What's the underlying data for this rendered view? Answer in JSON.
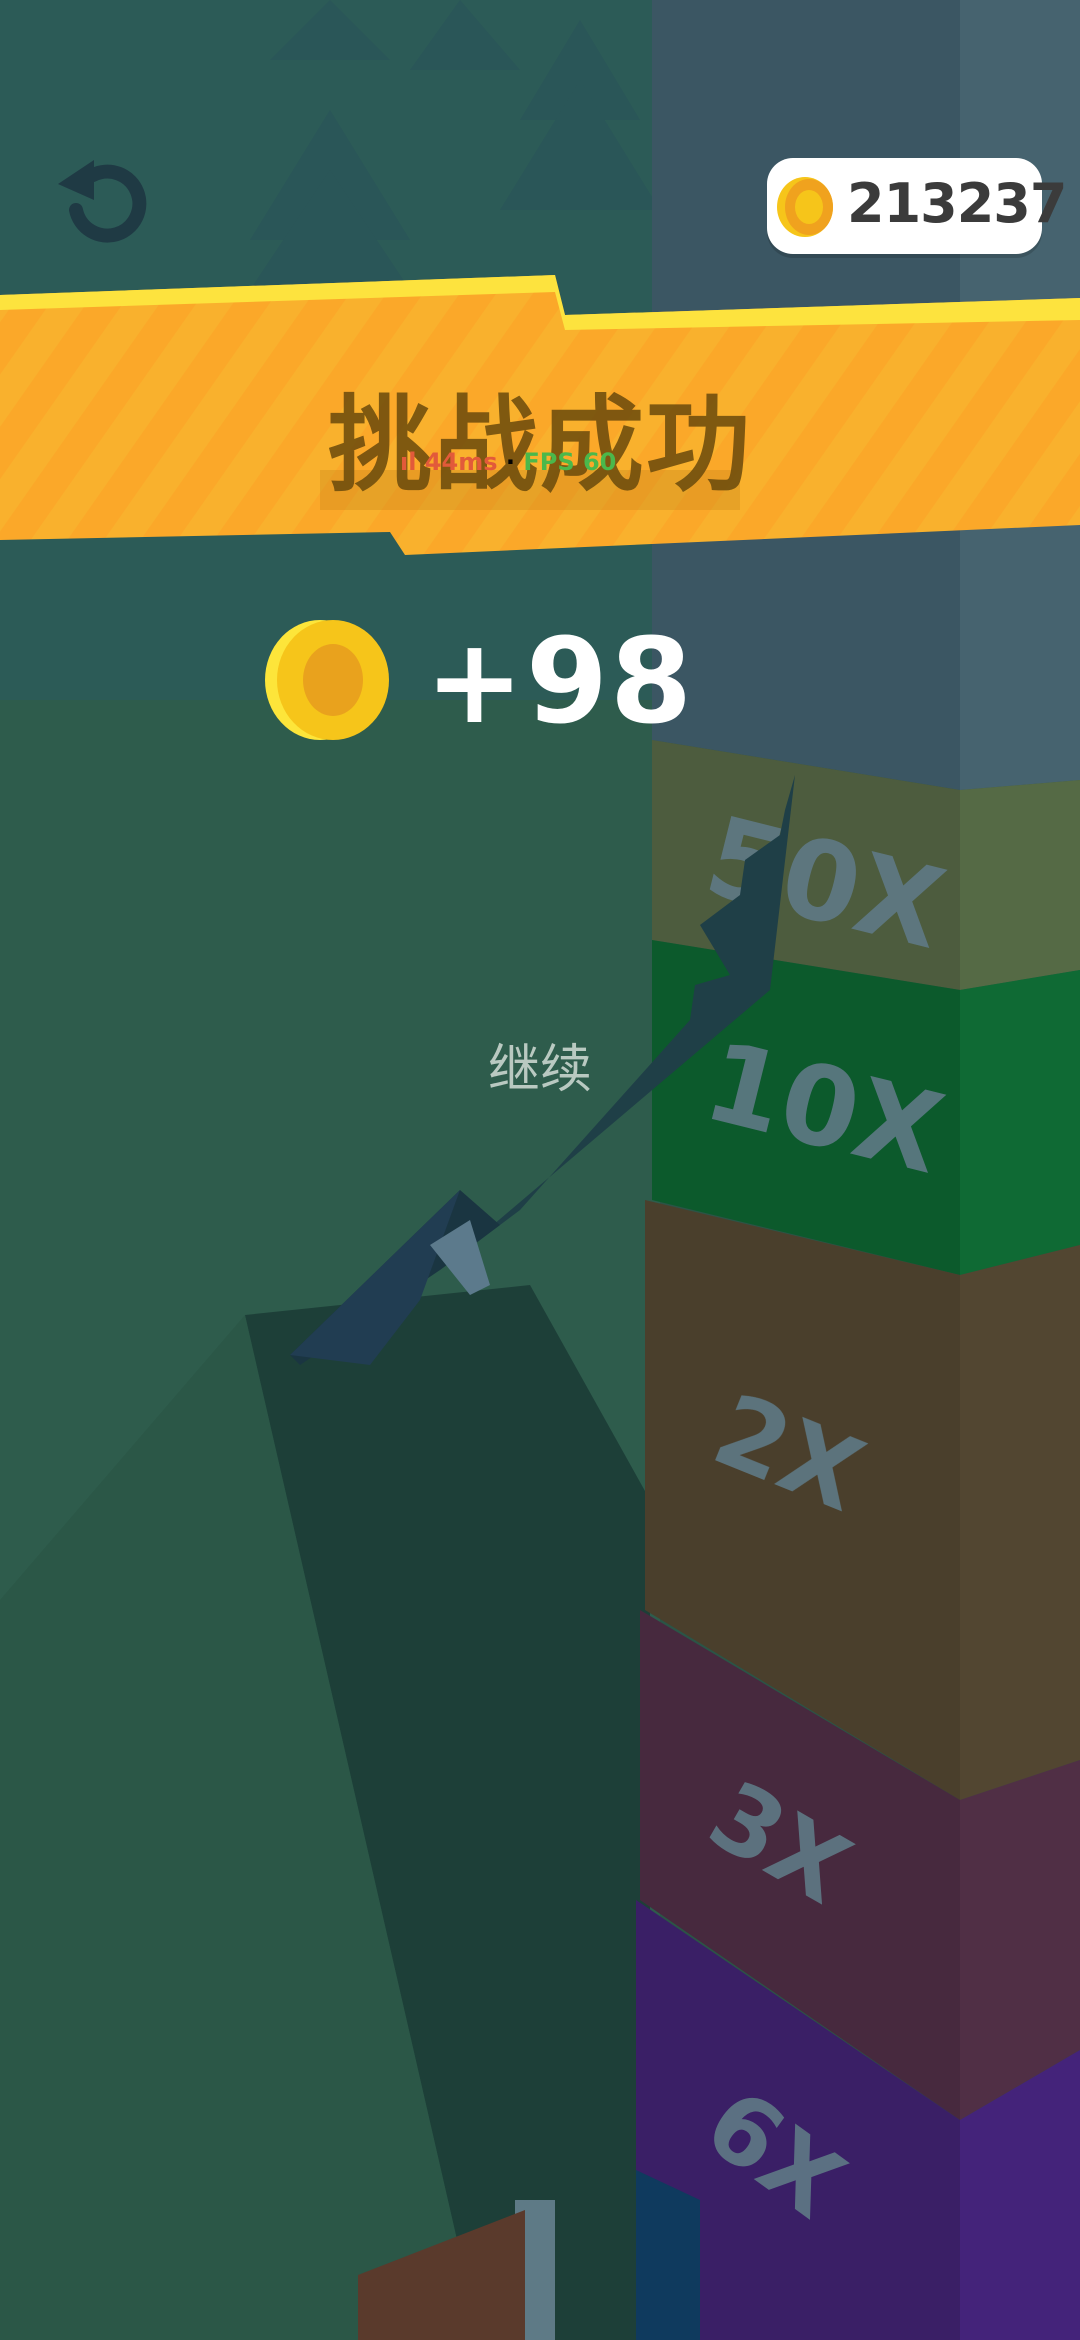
{
  "hud": {
    "coins": "213237",
    "restart_icon": "restart-icon",
    "coin_icon": "coin-icon"
  },
  "result": {
    "title": "挑战成功",
    "reward": "+98",
    "continue_label": "继续"
  },
  "debug": {
    "ping": "ıl 44ms",
    "fps": "FPS 60"
  },
  "multipliers": [
    "50X",
    "10X",
    "2X",
    "3X",
    "6X"
  ],
  "colors": {
    "banner": "#f9a722",
    "coin": "#f6c51a",
    "background": "#2b5446"
  }
}
